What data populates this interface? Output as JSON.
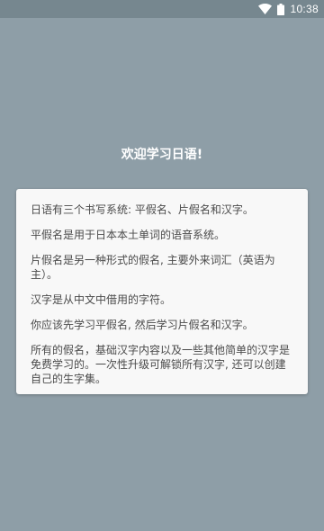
{
  "status_bar": {
    "time": "10:38",
    "icons": [
      "wifi-icon",
      "battery-icon"
    ]
  },
  "welcome": {
    "title": "欢迎学习日语!"
  },
  "info": {
    "paragraphs": [
      "日语有三个书写系统: 平假名、片假名和汉字。",
      "平假名是用于日本本土单词的语音系统。",
      "片假名是另一种形式的假名, 主要外来词汇（英语为主）。",
      "汉字是从中文中借用的字符。",
      "你应该先学习平假名, 然后学习片假名和汉字。",
      "所有的假名，基础汉字内容以及一些其他简单的汉字是免费学习的。一次性升级可解锁所有汉字, 还可以创建自己的生字集。"
    ]
  },
  "colors": {
    "background": "#8e9ea7",
    "status_bar": "#76878f",
    "card": "#f8f8f8",
    "text": "#4a4a4a"
  }
}
